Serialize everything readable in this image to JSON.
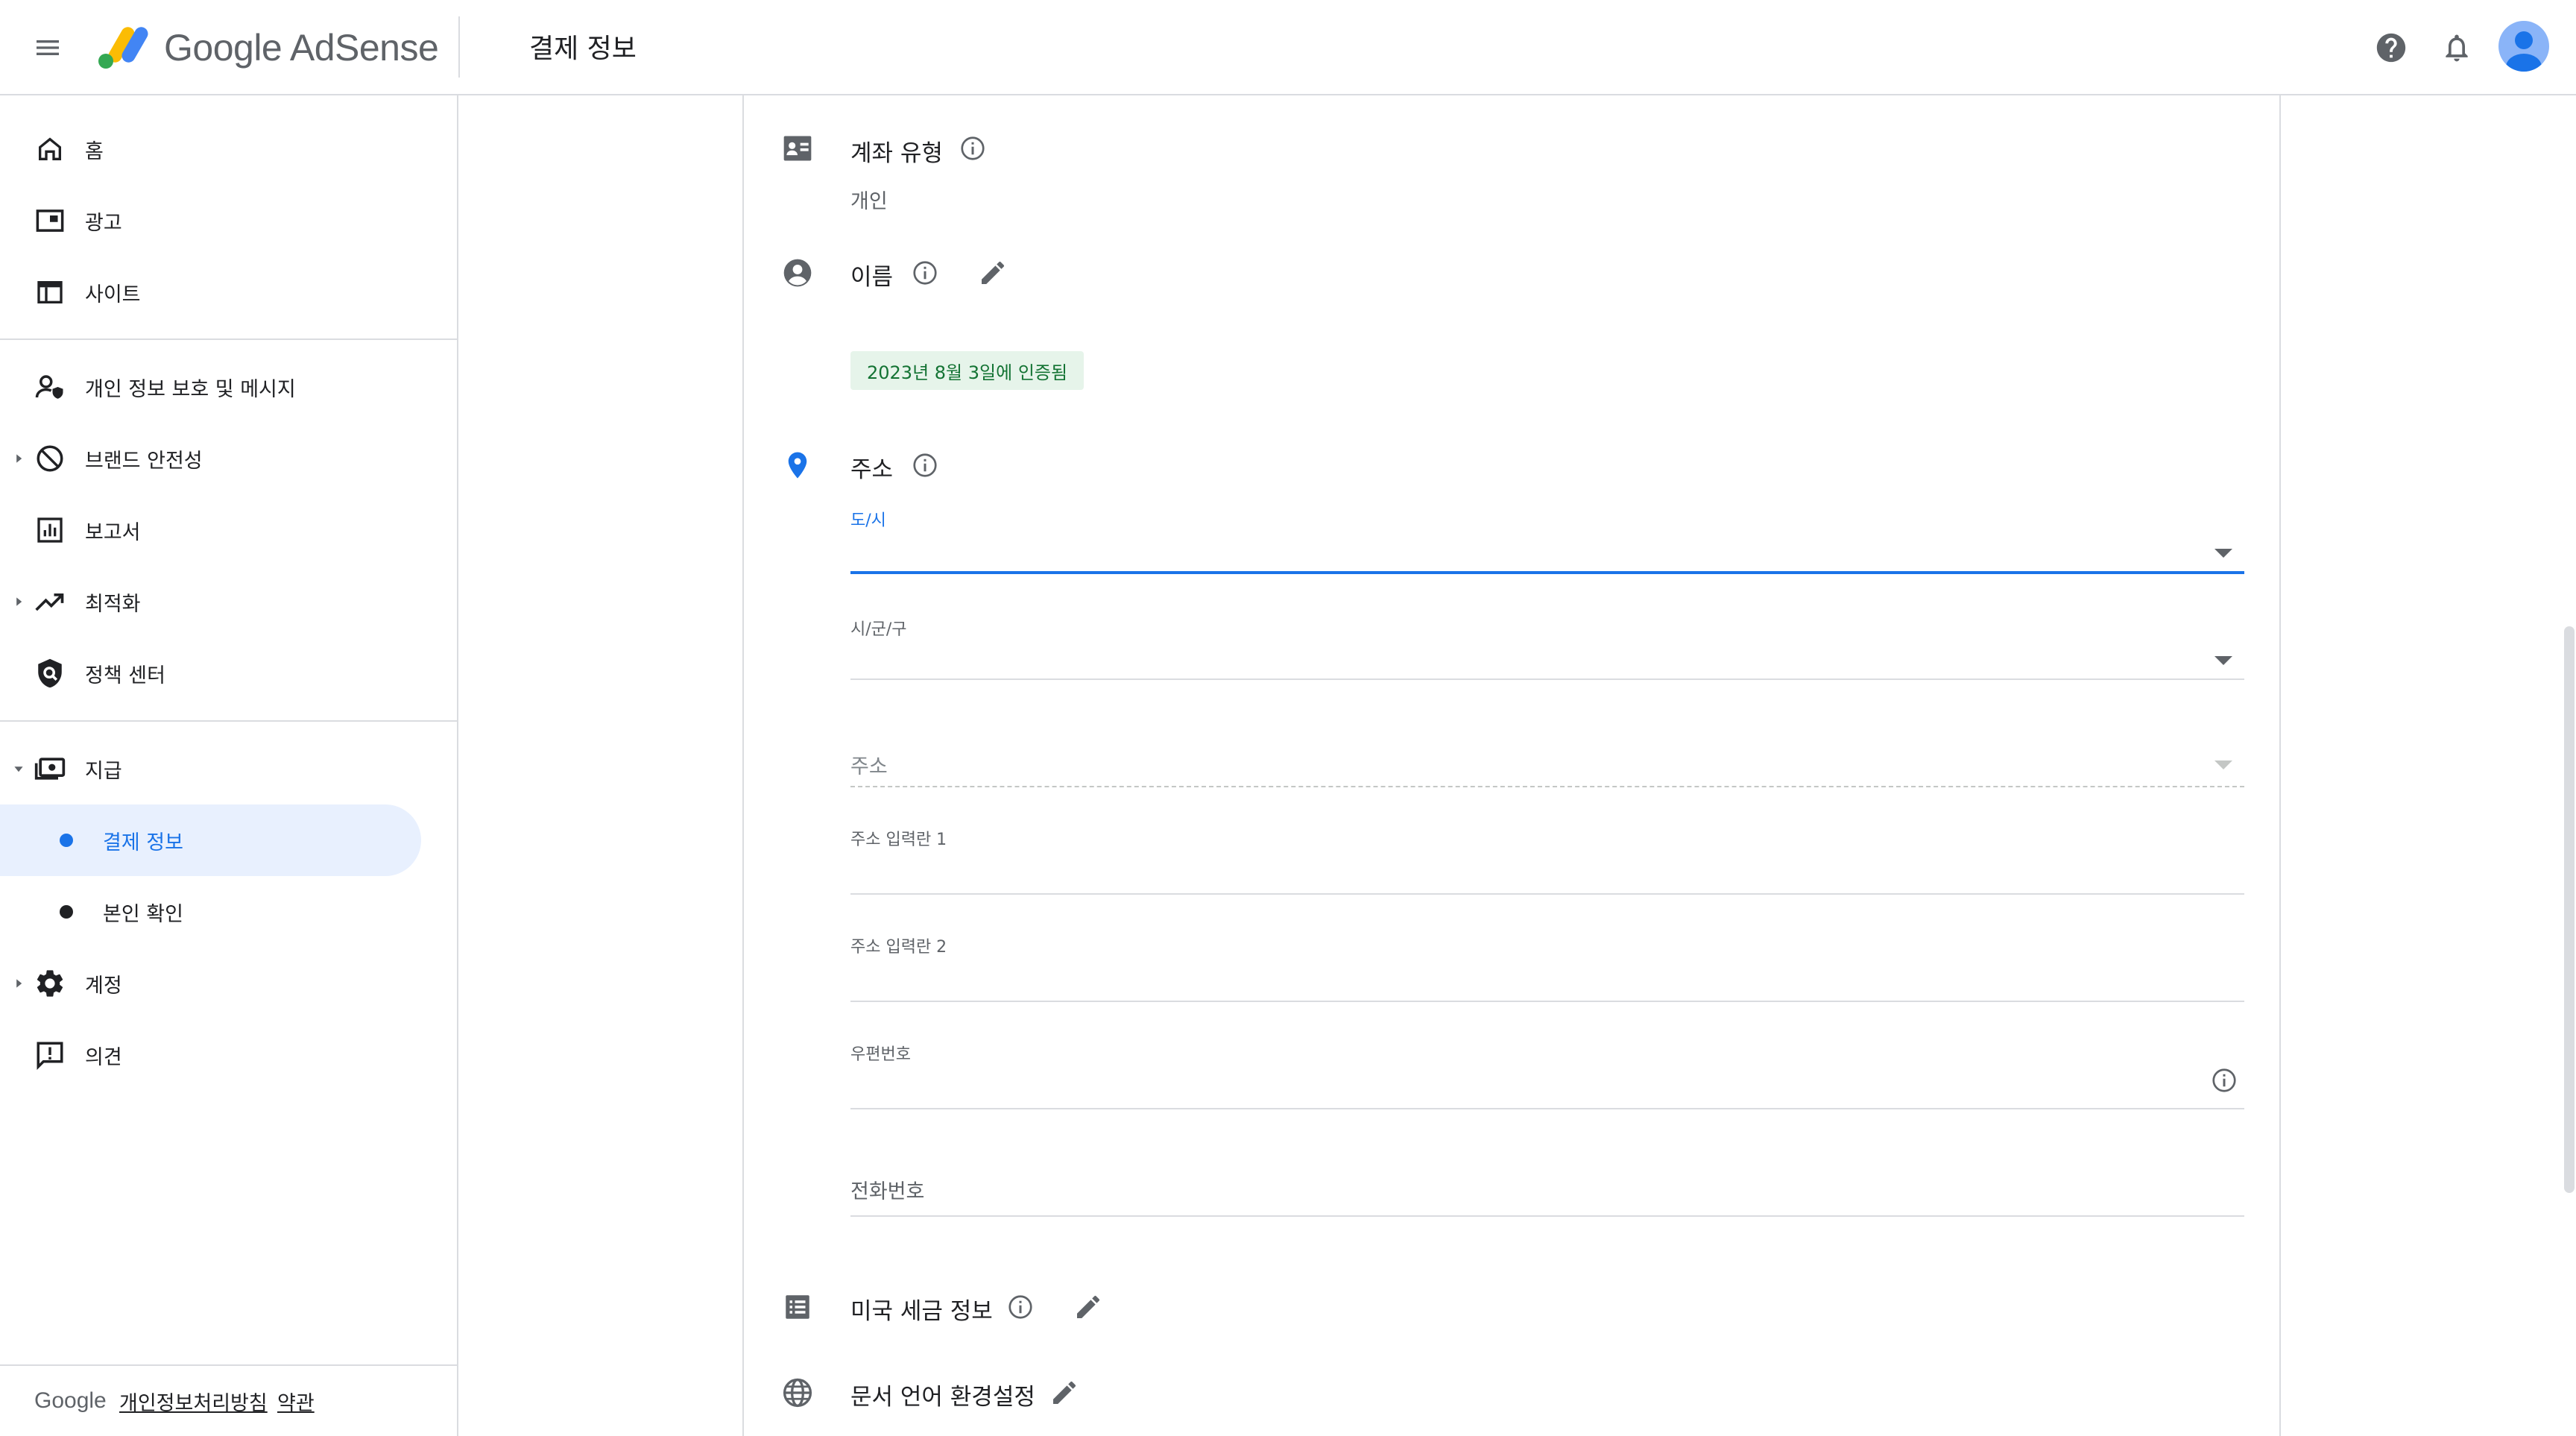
{
  "header": {
    "app_name": "Google AdSense",
    "page_title": "결제 정보",
    "icons": [
      "menu-icon",
      "help-icon",
      "notifications-icon",
      "avatar"
    ]
  },
  "sidebar": {
    "items": [
      {
        "label": "홈",
        "icon": "home-icon"
      },
      {
        "label": "광고",
        "icon": "ads-icon"
      },
      {
        "label": "사이트",
        "icon": "sites-icon"
      },
      {
        "label": "개인 정보 보호 및 메시지",
        "icon": "privacy-icon"
      },
      {
        "label": "브랜드 안전성",
        "icon": "block-icon"
      },
      {
        "label": "보고서",
        "icon": "reports-icon"
      },
      {
        "label": "최적화",
        "icon": "trending-icon"
      },
      {
        "label": "정책 센터",
        "icon": "policy-icon"
      },
      {
        "label": "지급",
        "icon": "payments-icon"
      },
      {
        "label": "결제 정보",
        "icon": "dot"
      },
      {
        "label": "본인 확인",
        "icon": "dot"
      },
      {
        "label": "계정",
        "icon": "settings-icon"
      },
      {
        "label": "의견",
        "icon": "feedback-icon"
      }
    ],
    "active": "결제 정보",
    "footer": {
      "brand": "Google",
      "privacy": "개인정보처리방침",
      "terms": "약관"
    }
  },
  "main": {
    "account_type": {
      "label": "계좌 유형",
      "value": "개인"
    },
    "name": {
      "label": "이름",
      "verified": "2023년 8월 3일에 인증됨"
    },
    "address": {
      "label": "주소",
      "fields": {
        "city": "도/시",
        "district": "시/군/구",
        "address": "주소",
        "line1": "주소 입력란 1",
        "line2": "주소 입력란 2",
        "postal": "우편번호",
        "phone": "전화번호"
      }
    },
    "us_tax": {
      "label": "미국 세금 정보"
    },
    "doc_lang": {
      "label": "문서 언어 환경설정"
    }
  },
  "colors": {
    "accent": "#1a73e8",
    "chip_bg": "#e6f4ea",
    "chip_text": "#137333",
    "active_bg": "#e8f0fe"
  }
}
